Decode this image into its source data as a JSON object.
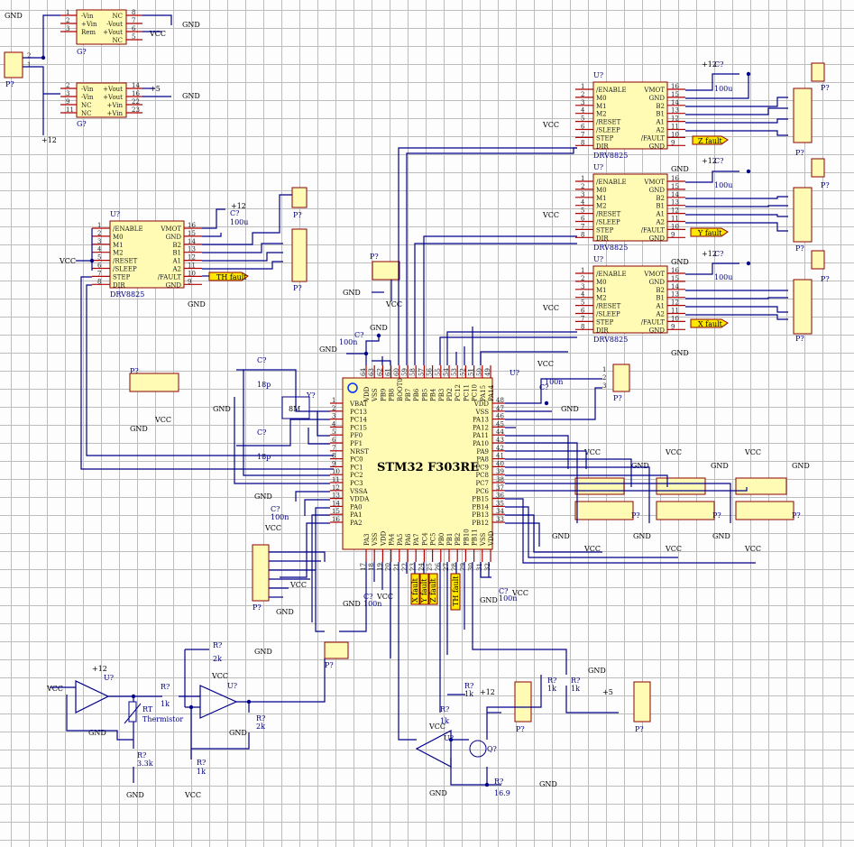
{
  "mcu": {
    "designator": "U?",
    "part": "STM32 F303RE",
    "pins_top": [
      "VDD",
      "VSS",
      "PB9",
      "PB8",
      "BOOT0",
      "PB7",
      "PB6",
      "PB5",
      "PB4",
      "PB3",
      "PD2",
      "PC12",
      "PC11",
      "PC10",
      "PA15",
      "PA14"
    ],
    "pins_top_num": [
      "64",
      "63",
      "62",
      "61",
      "60",
      "59",
      "58",
      "57",
      "56",
      "55",
      "54",
      "53",
      "52",
      "51",
      "50",
      "49"
    ],
    "pins_left": [
      "VBAT",
      "PC13",
      "PC14",
      "PC15",
      "PF0",
      "PF1",
      "NRST",
      "PC0",
      "PC1",
      "PC2",
      "PC3",
      "VSSA",
      "VDDA",
      "PA0",
      "PA1",
      "PA2"
    ],
    "pins_left_num": [
      "1",
      "2",
      "3",
      "4",
      "5",
      "6",
      "7",
      "8",
      "9",
      "10",
      "11",
      "12",
      "13",
      "14",
      "15",
      "16"
    ],
    "pins_right": [
      "VDD",
      "VSS",
      "PA13",
      "PA12",
      "PA11",
      "PA10",
      "PA9",
      "PA8",
      "PC9",
      "PC8",
      "PC7",
      "PC6",
      "PB15",
      "PB14",
      "PB13",
      "PB12"
    ],
    "pins_right_num": [
      "48",
      "47",
      "46",
      "45",
      "44",
      "43",
      "42",
      "41",
      "40",
      "39",
      "38",
      "37",
      "36",
      "35",
      "34",
      "33"
    ],
    "pins_bottom": [
      "PA3",
      "VSS",
      "VDD",
      "PA4",
      "PA5",
      "PA6",
      "PA7",
      "PC4",
      "PC5",
      "PB0",
      "PB1",
      "PB2",
      "PB10",
      "PB11",
      "VSS",
      "VDD"
    ],
    "pins_bottom_num": [
      "17",
      "18",
      "19",
      "20",
      "21",
      "22",
      "23",
      "24",
      "25",
      "26",
      "27",
      "28",
      "29",
      "30",
      "31",
      "32"
    ]
  },
  "drivers": [
    {
      "designator": "U?",
      "part": "DRV8825",
      "left": [
        "/ENABLE",
        "M0",
        "M1",
        "M2",
        "/RESET",
        "/SLEEP",
        "STEP",
        "DIR"
      ],
      "left_num": [
        "1",
        "2",
        "3",
        "4",
        "5",
        "6",
        "7",
        "8"
      ],
      "right": [
        "VMOT",
        "GND",
        "B2",
        "B1",
        "A1",
        "A2",
        "/FAULT",
        "GND"
      ],
      "right_num": [
        "16",
        "15",
        "14",
        "13",
        "12",
        "11",
        "10",
        "9"
      ],
      "fault": "TH fault"
    },
    {
      "designator": "U?",
      "part": "DRV8825",
      "left": [
        "/ENABLE",
        "M0",
        "M1",
        "M2",
        "/RESET",
        "/SLEEP",
        "STEP",
        "DIR"
      ],
      "left_num": [
        "1",
        "2",
        "3",
        "4",
        "5",
        "6",
        "7",
        "8"
      ],
      "right": [
        "VMOT",
        "GND",
        "B2",
        "B1",
        "A1",
        "A2",
        "/FAULT",
        "GND"
      ],
      "right_num": [
        "16",
        "15",
        "14",
        "13",
        "12",
        "11",
        "10",
        "9"
      ],
      "fault": "Z fault"
    },
    {
      "designator": "U?",
      "part": "DRV8825",
      "left": [
        "/ENABLE",
        "M0",
        "M1",
        "M2",
        "/RESET",
        "/SLEEP",
        "STEP",
        "DIR"
      ],
      "left_num": [
        "1",
        "2",
        "3",
        "4",
        "5",
        "6",
        "7",
        "8"
      ],
      "right": [
        "VMOT",
        "GND",
        "B2",
        "B1",
        "A1",
        "A2",
        "/FAULT",
        "GND"
      ],
      "right_num": [
        "16",
        "15",
        "14",
        "13",
        "12",
        "11",
        "10",
        "9"
      ],
      "fault": "Y fault"
    },
    {
      "designator": "U?",
      "part": "DRV8825",
      "left": [
        "/ENABLE",
        "M0",
        "M1",
        "M2",
        "/RESET",
        "/SLEEP",
        "STEP",
        "DIR"
      ],
      "left_num": [
        "1",
        "2",
        "3",
        "4",
        "5",
        "6",
        "7",
        "8"
      ],
      "right": [
        "VMOT",
        "GND",
        "B2",
        "B1",
        "A1",
        "A2",
        "/FAULT",
        "GND"
      ],
      "right_num": [
        "16",
        "15",
        "14",
        "13",
        "12",
        "11",
        "10",
        "9"
      ],
      "fault": "X fault"
    }
  ],
  "dcdc": [
    {
      "designator": "G?",
      "left": [
        "-Vin",
        "+Vin",
        "Rem"
      ],
      "left_num": [
        "1",
        "2",
        "3"
      ],
      "right": [
        "NC",
        "-Vout",
        "+Vout",
        "NC"
      ],
      "right_num": [
        "8",
        "7",
        "6",
        "5"
      ]
    },
    {
      "designator": "G?",
      "left": [
        "-Vin",
        "-Vin",
        "NC",
        "NC"
      ],
      "left_num": [
        "2",
        "3",
        "9",
        "11"
      ],
      "right": [
        "+Vout",
        "+Vout",
        "+Vin",
        "+Vin"
      ],
      "right_num": [
        "14",
        "16",
        "22",
        "23"
      ]
    }
  ],
  "labels": {
    "connector": "P?",
    "cap": "C?",
    "res": "R?",
    "opamp": "U?",
    "transistor": "Q?",
    "crystal": "Y?",
    "crystal_value": "8M",
    "cap_100u": "100u",
    "cap_100n": "100n",
    "cap_18p": "18p",
    "thermistor_des": "RT",
    "thermistor": "Thermistor",
    "r_2k": "2k",
    "r_1k": "1k",
    "r_3k3": "3.3k",
    "r_16_9": "16.9",
    "gnd": "GND",
    "vcc": "VCC",
    "p12": "+12",
    "p5": "+5",
    "faults": [
      "X fault",
      "Y fault",
      "Z fault",
      "TH fault"
    ]
  }
}
